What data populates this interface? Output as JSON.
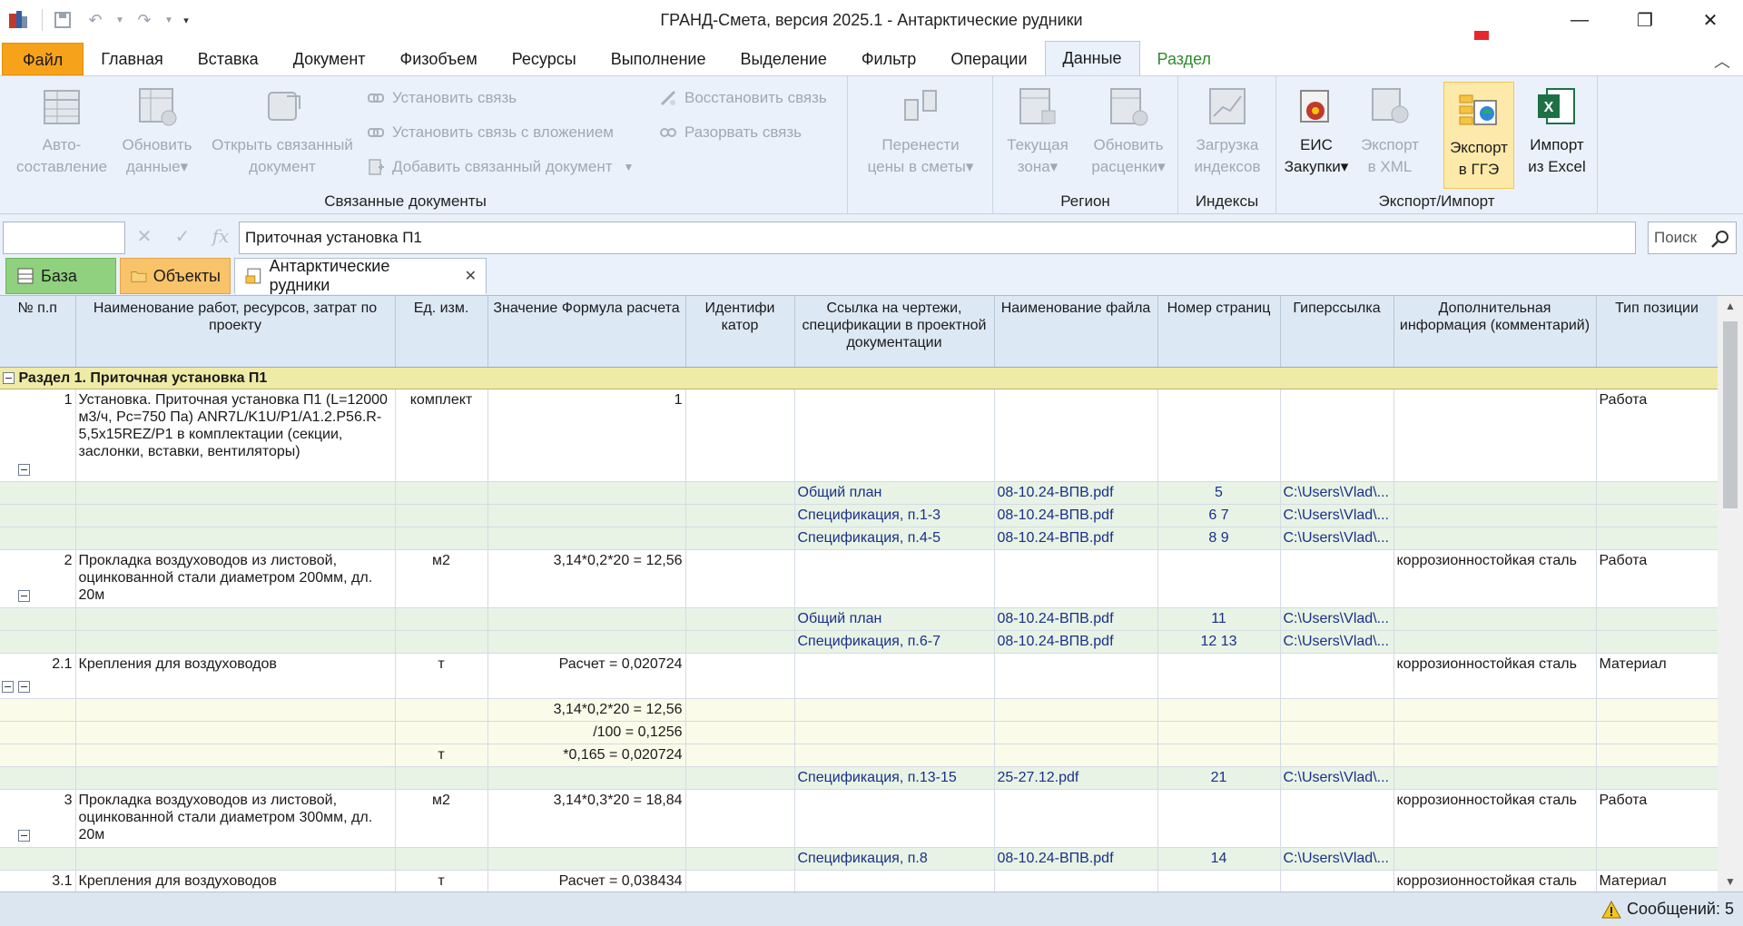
{
  "window": {
    "title": "ГРАНД-Смета, версия 2025.1 - Антарктические рудники"
  },
  "menu": {
    "tabs": [
      {
        "label": "Файл"
      },
      {
        "label": "Главная"
      },
      {
        "label": "Вставка"
      },
      {
        "label": "Документ"
      },
      {
        "label": "Физобъем"
      },
      {
        "label": "Ресурсы"
      },
      {
        "label": "Выполнение"
      },
      {
        "label": "Выделение"
      },
      {
        "label": "Фильтр"
      },
      {
        "label": "Операции"
      },
      {
        "label": "Данные"
      },
      {
        "label": "Раздел"
      }
    ]
  },
  "ribbon": {
    "autocompose": {
      "l1": "Авто-",
      "l2": "составление"
    },
    "update_data": {
      "l1": "Обновить",
      "l2": "данные"
    },
    "open_linked": {
      "l1": "Открыть связанный",
      "l2": "документ"
    },
    "set_link": "Установить связь",
    "set_link_attach": "Установить связь с вложением",
    "add_linked": "Добавить связанный документ",
    "restore_link": "Восстановить связь",
    "break_link": "Разорвать связь",
    "linked_group": "Связанные документы",
    "transfer_prices": {
      "l1": "Перенести",
      "l2": "цены в сметы"
    },
    "current_zone": {
      "l1": "Текущая",
      "l2": "зона"
    },
    "update_rates": {
      "l1": "Обновить",
      "l2": "расценки"
    },
    "region_group": "Регион",
    "load_indices": {
      "l1": "Загрузка",
      "l2": "индексов"
    },
    "indices_group": "Индексы",
    "eis": {
      "l1": "ЕИС",
      "l2": "Закупки"
    },
    "export_xml": {
      "l1": "Экспорт",
      "l2": "в XML"
    },
    "export_gge": {
      "l1": "Экспорт",
      "l2": "в ГГЭ"
    },
    "import_excel": {
      "l1": "Импорт",
      "l2": "из Excel"
    },
    "export_group": "Экспорт/Импорт"
  },
  "formula_bar": {
    "namebox": "",
    "value": "Приточная установка П1",
    "search_placeholder": "Поиск"
  },
  "doc_tabs": [
    {
      "label": "База"
    },
    {
      "label": "Объекты"
    },
    {
      "label": "Антарктические рудники"
    }
  ],
  "columns": [
    "№ п.п",
    "Наименование работ, ресурсов, затрат по проекту",
    "Ед. изм.",
    "Значение Формула расчета",
    "Идентифи катор",
    "Ссылка на чертежи, спецификации в проектной документации",
    "Наименование файла",
    "Номер страниц",
    "Гиперссылка",
    "Дополнительная информация (комментарий)",
    "Тип позиции"
  ],
  "section_title": "Раздел 1. Приточная установка П1",
  "rows": [
    {
      "num": "1",
      "name": "Установка. Приточная установка  П1 (L=12000 м3/ч, Рс=750 Па) ANR7L/K1U/P1/A1.2.P56.R-5,5x15REZ/P1 в комплектации (секции, заслонки, вставки, вентиляторы)",
      "unit": "комплект",
      "value": "1",
      "comment": "",
      "type": "Работа"
    },
    {
      "link": "Общий план",
      "file": "08-10.24-ВПВ.pdf",
      "pages": "5",
      "href": "C:\\Users\\Vlad\\..."
    },
    {
      "link": "Спецификация, п.1-3",
      "file": "08-10.24-ВПВ.pdf",
      "pages": "6 7",
      "href": "C:\\Users\\Vlad\\..."
    },
    {
      "link": "Спецификация, п.4-5",
      "file": "08-10.24-ВПВ.pdf",
      "pages": "8 9",
      "href": "C:\\Users\\Vlad\\..."
    },
    {
      "num": "2",
      "name": "Прокладка воздуховодов из листовой, оцинкованной стали диаметром 200мм, дл. 20м",
      "unit": "м2",
      "value": "3,14*0,2*20 = 12,56",
      "comment": "коррозионностойкая сталь",
      "type": "Работа"
    },
    {
      "link": "Общий план",
      "file": "08-10.24-ВПВ.pdf",
      "pages": "11",
      "href": "C:\\Users\\Vlad\\..."
    },
    {
      "link": "Спецификация, п.6-7",
      "file": "08-10.24-ВПВ.pdf",
      "pages": "12 13",
      "href": "C:\\Users\\Vlad\\..."
    },
    {
      "num": "2.1",
      "name": "Крепления для воздуховодов",
      "unit": "т",
      "value": "Расчет = 0,020724",
      "comment": "коррозионностойкая сталь",
      "type": "Материал"
    },
    {
      "formula": "3,14*0,2*20 = 12,56",
      "unit": ""
    },
    {
      "formula": "/100 = 0,1256",
      "unit": ""
    },
    {
      "formula": "*0,165 = 0,020724",
      "unit": "т"
    },
    {
      "link": "Спецификация, п.13-15",
      "file": "25-27.12.pdf",
      "pages": "21",
      "href": "C:\\Users\\Vlad\\..."
    },
    {
      "num": "3",
      "name": "Прокладка воздуховодов из листовой, оцинкованной стали диаметром 300мм, дл. 20м",
      "unit": "м2",
      "value": "3,14*0,3*20 = 18,84",
      "comment": "коррозионностойкая сталь",
      "type": "Работа"
    },
    {
      "link": "Спецификация, п.8",
      "file": "08-10.24-ВПВ.pdf",
      "pages": "14",
      "href": "C:\\Users\\Vlad\\..."
    },
    {
      "num": "3.1",
      "name": "Крепления для воздуховодов",
      "unit": "т",
      "value": "Расчет = 0,038434",
      "comment": "коррозионностойкая сталь",
      "type": "Материал"
    }
  ],
  "status": {
    "messages": "Сообщений: 5"
  },
  "colors": {
    "accent": "#f6a21b",
    "ribbon": "#eaf1fa",
    "section": "#eeeba6",
    "link_row": "#e8f3e5",
    "highlight": "#fde9a9",
    "arrow": "#e8262b"
  }
}
